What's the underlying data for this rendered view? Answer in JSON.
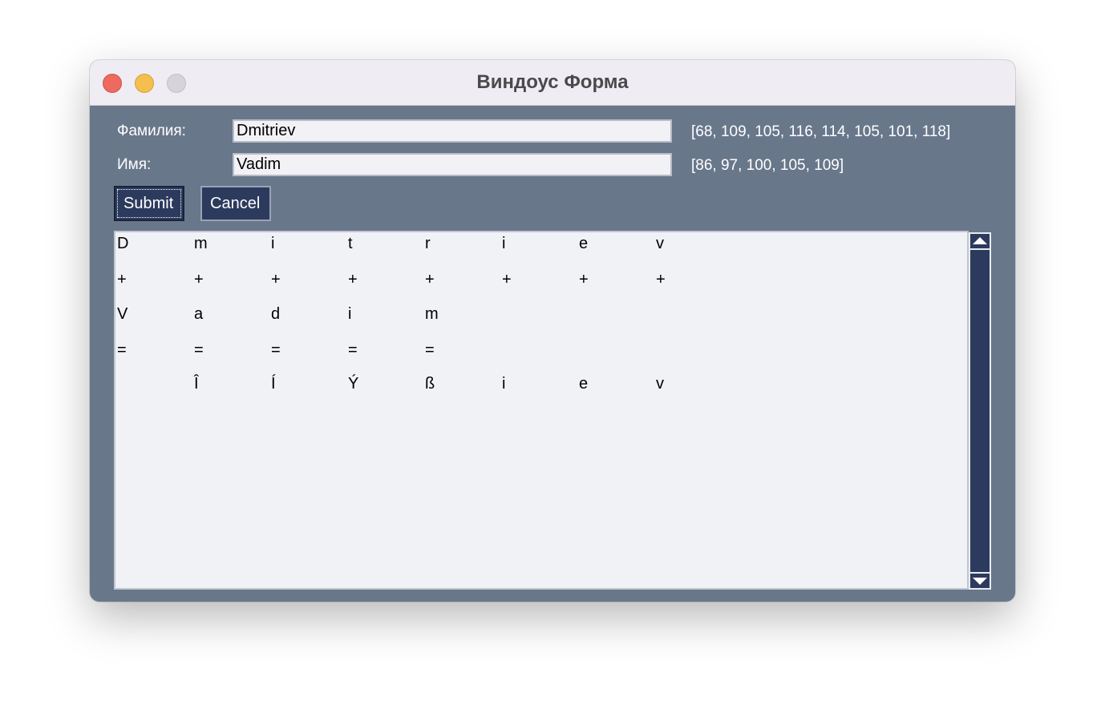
{
  "window": {
    "title": "Виндоус Форма"
  },
  "form": {
    "surname_label": "Фамилия:",
    "surname_value": "Dmitriev",
    "surname_codes": "[68, 109, 105, 116, 114, 105, 101, 118]",
    "name_label": "Имя:",
    "name_value": "Vadim",
    "name_codes": "[86, 97, 100, 105, 109]"
  },
  "buttons": {
    "submit": "Submit",
    "cancel": "Cancel"
  },
  "output": {
    "rows": [
      [
        "D",
        "m",
        "i",
        "t",
        "r",
        "i",
        "e",
        "v"
      ],
      [
        "+",
        "+",
        "+",
        "+",
        "+",
        "+",
        "+",
        "+"
      ],
      [
        "V",
        "a",
        "d",
        "i",
        "m",
        "",
        "",
        ""
      ],
      [
        "=",
        "=",
        "=",
        "=",
        "=",
        "",
        "",
        ""
      ],
      [
        "",
        "Î",
        "Í",
        "Ý",
        "ß",
        "i",
        "e",
        "v"
      ]
    ]
  },
  "icons": {
    "scroll_up": "triangle-up-icon",
    "scroll_down": "triangle-down-icon"
  },
  "colors": {
    "window_bg": "#69778b",
    "button_bg": "#2c3a5e",
    "close": "#ec6a5e",
    "minimize": "#f4bf4f",
    "maximize": "#d6d4da"
  }
}
